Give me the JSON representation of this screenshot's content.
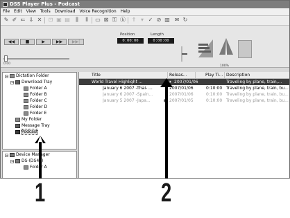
{
  "app": {
    "title": "DSS Player Plus - Podcast"
  },
  "menu": [
    "File",
    "Edit",
    "View",
    "Tools",
    "Download",
    "Voice Recognition",
    "Help"
  ],
  "player": {
    "position_label": "Position",
    "position_value": "0:00:00",
    "length_label": "Length",
    "length_value": "0:00:00",
    "seek_start": "0:00",
    "speed_label": "100%"
  },
  "tree": {
    "root": "Dictation Folder",
    "download_tray": "Download Tray",
    "folders": [
      "Folder A",
      "Folder B",
      "Folder C",
      "Folder D",
      "Folder E"
    ],
    "my_folder": "My Folder",
    "message_tray": "Message Tray",
    "podcast": "Podcast",
    "device_manager": "Device Manager",
    "device": "DS-(DS40)",
    "device_sub": "Folder A"
  },
  "list": {
    "columns": [
      "Title",
      "Releas...",
      "Play Ti...",
      "Description"
    ],
    "rows": [
      {
        "title": "World Travel Highlight ...",
        "release": "2007/01/06",
        "play_time": "",
        "description": "Traveling by plane, train,..."
      },
      {
        "title": "January 6 2007 -Thai- ...",
        "release": "2007/01/06",
        "play_time": "0:10:00",
        "description": "Traveling by plane, train, bu..."
      },
      {
        "title": "January 6 2007 -Spain...",
        "release": "2007/01/06",
        "play_time": "0:10:00",
        "description": "Traveling by plane, train, bu..."
      },
      {
        "title": "January 5 2007 -Japa...",
        "release": "2007/01/05",
        "play_time": "0:10:00",
        "description": "Traveling by plane, train, bu..."
      }
    ]
  },
  "callouts": {
    "one": "1",
    "two": "2"
  }
}
